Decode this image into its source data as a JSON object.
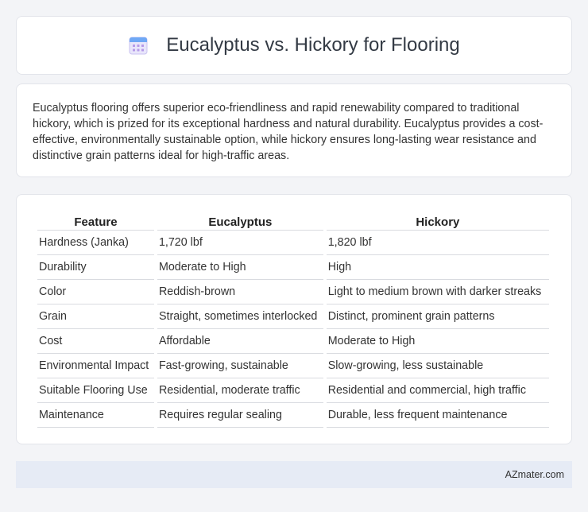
{
  "header": {
    "title": "Eucalyptus vs. Hickory for Flooring",
    "icon": "calendar-icon"
  },
  "intro": {
    "text": "Eucalyptus flooring offers superior eco-friendliness and rapid renewability compared to traditional hickory, which is prized for its exceptional hardness and natural durability. Eucalyptus provides a cost-effective, environmentally sustainable option, while hickory ensures long-lasting wear resistance and distinctive grain patterns ideal for high-traffic areas."
  },
  "table": {
    "headers": [
      "Feature",
      "Eucalyptus",
      "Hickory"
    ],
    "rows": [
      [
        "Hardness (Janka)",
        "1,720 lbf",
        "1,820 lbf"
      ],
      [
        "Durability",
        "Moderate to High",
        "High"
      ],
      [
        "Color",
        "Reddish-brown",
        "Light to medium brown with darker streaks"
      ],
      [
        "Grain",
        "Straight, sometimes interlocked",
        "Distinct, prominent grain patterns"
      ],
      [
        "Cost",
        "Affordable",
        "Moderate to High"
      ],
      [
        "Environmental Impact",
        "Fast-growing, sustainable",
        "Slow-growing, less sustainable"
      ],
      [
        "Suitable Flooring Use",
        "Residential, moderate traffic",
        "Residential and commercial, high traffic"
      ],
      [
        "Maintenance",
        "Requires regular sealing",
        "Durable, less frequent maintenance"
      ]
    ]
  },
  "footer": {
    "text": "AZmater.com"
  }
}
